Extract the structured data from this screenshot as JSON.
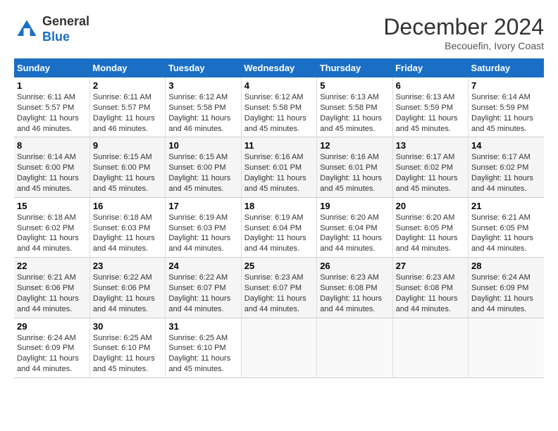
{
  "header": {
    "logo_line1": "General",
    "logo_line2": "Blue",
    "month": "December 2024",
    "location": "Becouefin, Ivory Coast"
  },
  "days_of_week": [
    "Sunday",
    "Monday",
    "Tuesday",
    "Wednesday",
    "Thursday",
    "Friday",
    "Saturday"
  ],
  "weeks": [
    [
      {
        "day": "1",
        "info": "Sunrise: 6:11 AM\nSunset: 5:57 PM\nDaylight: 11 hours\nand 46 minutes."
      },
      {
        "day": "2",
        "info": "Sunrise: 6:11 AM\nSunset: 5:57 PM\nDaylight: 11 hours\nand 46 minutes."
      },
      {
        "day": "3",
        "info": "Sunrise: 6:12 AM\nSunset: 5:58 PM\nDaylight: 11 hours\nand 46 minutes."
      },
      {
        "day": "4",
        "info": "Sunrise: 6:12 AM\nSunset: 5:58 PM\nDaylight: 11 hours\nand 45 minutes."
      },
      {
        "day": "5",
        "info": "Sunrise: 6:13 AM\nSunset: 5:58 PM\nDaylight: 11 hours\nand 45 minutes."
      },
      {
        "day": "6",
        "info": "Sunrise: 6:13 AM\nSunset: 5:59 PM\nDaylight: 11 hours\nand 45 minutes."
      },
      {
        "day": "7",
        "info": "Sunrise: 6:14 AM\nSunset: 5:59 PM\nDaylight: 11 hours\nand 45 minutes."
      }
    ],
    [
      {
        "day": "8",
        "info": "Sunrise: 6:14 AM\nSunset: 6:00 PM\nDaylight: 11 hours\nand 45 minutes."
      },
      {
        "day": "9",
        "info": "Sunrise: 6:15 AM\nSunset: 6:00 PM\nDaylight: 11 hours\nand 45 minutes."
      },
      {
        "day": "10",
        "info": "Sunrise: 6:15 AM\nSunset: 6:00 PM\nDaylight: 11 hours\nand 45 minutes."
      },
      {
        "day": "11",
        "info": "Sunrise: 6:16 AM\nSunset: 6:01 PM\nDaylight: 11 hours\nand 45 minutes."
      },
      {
        "day": "12",
        "info": "Sunrise: 6:16 AM\nSunset: 6:01 PM\nDaylight: 11 hours\nand 45 minutes."
      },
      {
        "day": "13",
        "info": "Sunrise: 6:17 AM\nSunset: 6:02 PM\nDaylight: 11 hours\nand 45 minutes."
      },
      {
        "day": "14",
        "info": "Sunrise: 6:17 AM\nSunset: 6:02 PM\nDaylight: 11 hours\nand 44 minutes."
      }
    ],
    [
      {
        "day": "15",
        "info": "Sunrise: 6:18 AM\nSunset: 6:02 PM\nDaylight: 11 hours\nand 44 minutes."
      },
      {
        "day": "16",
        "info": "Sunrise: 6:18 AM\nSunset: 6:03 PM\nDaylight: 11 hours\nand 44 minutes."
      },
      {
        "day": "17",
        "info": "Sunrise: 6:19 AM\nSunset: 6:03 PM\nDaylight: 11 hours\nand 44 minutes."
      },
      {
        "day": "18",
        "info": "Sunrise: 6:19 AM\nSunset: 6:04 PM\nDaylight: 11 hours\nand 44 minutes."
      },
      {
        "day": "19",
        "info": "Sunrise: 6:20 AM\nSunset: 6:04 PM\nDaylight: 11 hours\nand 44 minutes."
      },
      {
        "day": "20",
        "info": "Sunrise: 6:20 AM\nSunset: 6:05 PM\nDaylight: 11 hours\nand 44 minutes."
      },
      {
        "day": "21",
        "info": "Sunrise: 6:21 AM\nSunset: 6:05 PM\nDaylight: 11 hours\nand 44 minutes."
      }
    ],
    [
      {
        "day": "22",
        "info": "Sunrise: 6:21 AM\nSunset: 6:06 PM\nDaylight: 11 hours\nand 44 minutes."
      },
      {
        "day": "23",
        "info": "Sunrise: 6:22 AM\nSunset: 6:06 PM\nDaylight: 11 hours\nand 44 minutes."
      },
      {
        "day": "24",
        "info": "Sunrise: 6:22 AM\nSunset: 6:07 PM\nDaylight: 11 hours\nand 44 minutes."
      },
      {
        "day": "25",
        "info": "Sunrise: 6:23 AM\nSunset: 6:07 PM\nDaylight: 11 hours\nand 44 minutes."
      },
      {
        "day": "26",
        "info": "Sunrise: 6:23 AM\nSunset: 6:08 PM\nDaylight: 11 hours\nand 44 minutes."
      },
      {
        "day": "27",
        "info": "Sunrise: 6:23 AM\nSunset: 6:08 PM\nDaylight: 11 hours\nand 44 minutes."
      },
      {
        "day": "28",
        "info": "Sunrise: 6:24 AM\nSunset: 6:09 PM\nDaylight: 11 hours\nand 44 minutes."
      }
    ],
    [
      {
        "day": "29",
        "info": "Sunrise: 6:24 AM\nSunset: 6:09 PM\nDaylight: 11 hours\nand 44 minutes."
      },
      {
        "day": "30",
        "info": "Sunrise: 6:25 AM\nSunset: 6:10 PM\nDaylight: 11 hours\nand 45 minutes."
      },
      {
        "day": "31",
        "info": "Sunrise: 6:25 AM\nSunset: 6:10 PM\nDaylight: 11 hours\nand 45 minutes."
      },
      {
        "day": "",
        "info": ""
      },
      {
        "day": "",
        "info": ""
      },
      {
        "day": "",
        "info": ""
      },
      {
        "day": "",
        "info": ""
      }
    ]
  ]
}
